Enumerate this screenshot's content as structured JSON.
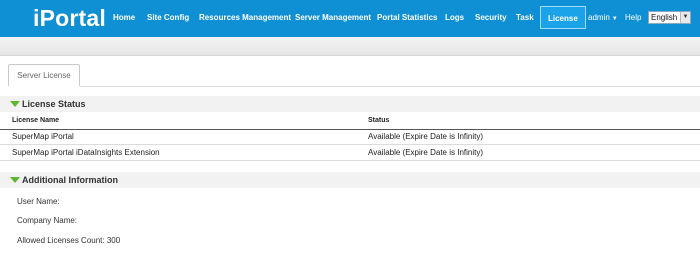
{
  "app": {
    "logo": "iPortal"
  },
  "nav": {
    "items": [
      "Home",
      "Site Config",
      "Resources Management",
      "Server Management",
      "Portal Statistics",
      "Logs",
      "Security",
      "Task",
      "License"
    ],
    "active": "License",
    "user": "admin",
    "help": "Help",
    "language": "English"
  },
  "tabs": {
    "active_label": "Server License"
  },
  "license_status": {
    "title": "License Status",
    "columns": [
      "License Name",
      "Status"
    ],
    "rows": [
      [
        "SuperMap iPortal",
        "Available (Expire Date is Infinity)"
      ],
      [
        "SuperMap iPortal iDataInsights Extension",
        "Available (Expire Date is Infinity)"
      ]
    ]
  },
  "additional_info": {
    "title": "Additional Information",
    "user_name": "User Name:",
    "company_name": "Company Name:",
    "allowed_count": "Allowed Licenses Count: 300"
  },
  "colors": {
    "header_bg": "#0f8fd4",
    "accent_green": "#5cb82e"
  }
}
